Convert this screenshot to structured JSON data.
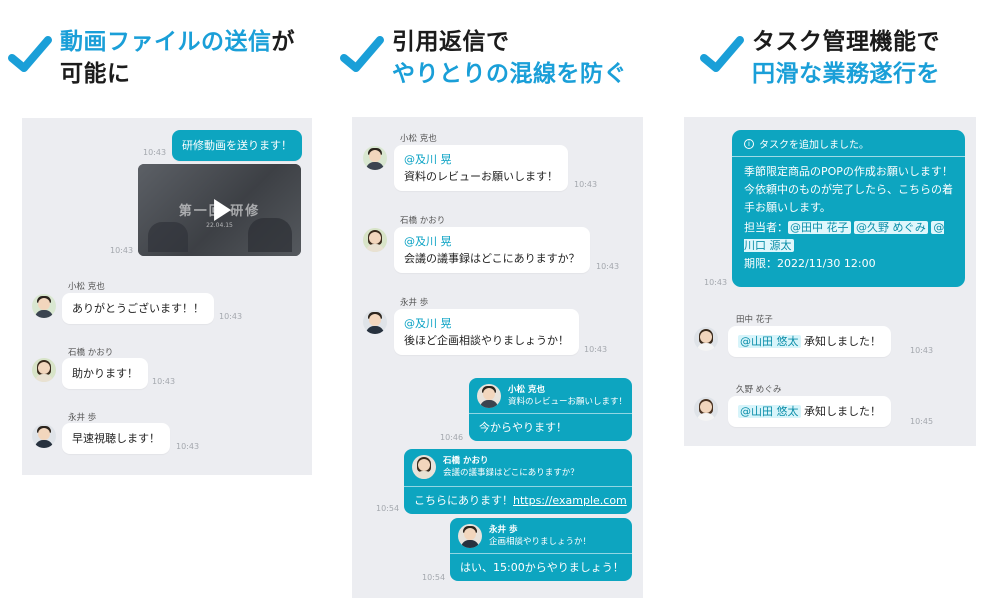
{
  "colors": {
    "accent": "#1a9fd8",
    "teal": "#0da5c0",
    "panel_bg": "#ecedf1"
  },
  "headings": [
    {
      "line1_blue": "動画ファイルの送信",
      "line1_dark": "が",
      "line2_dark": "可能に"
    },
    {
      "line1_dark": "引用返信で",
      "line2_blue": "やりとりの混線を防ぐ"
    },
    {
      "line1_dark": "タスク管理機能で",
      "line2_blue": "円滑な業務遂行を"
    }
  ],
  "panel1": {
    "sent_msg": "研修動画を送ります！",
    "sent_time": "10:43",
    "video_title": "第一回 研修",
    "video_date": "22.04.15",
    "video_time": "10:43",
    "msgs": [
      {
        "name": "小松 克也",
        "text": "ありがとうございます！！",
        "time": "10:43"
      },
      {
        "name": "石橋 かおり",
        "text": "助かります！",
        "time": "10:43"
      },
      {
        "name": "永井 歩",
        "text": "早速視聴します！",
        "time": "10:43"
      }
    ]
  },
  "panel2": {
    "msgs": [
      {
        "name": "小松 克也",
        "mention": "@及川 晃",
        "text": "資料のレビューお願いします！",
        "time": "10:43"
      },
      {
        "name": "石橋 かおり",
        "mention": "@及川 晃",
        "text": "会議の議事録はどこにありますか？",
        "time": "10:43"
      },
      {
        "name": "永井 歩",
        "mention": "@及川 晃",
        "text": "後ほど企画相談やりましょうか！",
        "time": "10:43"
      }
    ],
    "replies": [
      {
        "quote_name": "小松 克也",
        "quote_text": "資料のレビューお願いします！",
        "reply_text": "今からやります！",
        "reply_link": "",
        "time": "10:46"
      },
      {
        "quote_name": "石橋 かおり",
        "quote_text": "会議の議事録はどこにありますか？",
        "reply_text": "こちらにあります！",
        "reply_link": "https://example.com",
        "time": "10:54"
      },
      {
        "quote_name": "永井 歩",
        "quote_text": "企画相談やりましょうか！",
        "reply_text": "はい、15:00からやりましょう！",
        "reply_link": "",
        "time": "10:54"
      }
    ]
  },
  "panel3": {
    "task": {
      "header": "タスクを追加しました。",
      "info_icon": "info-icon",
      "body": "季節限定商品のPOPの作成お願いします！今依頼中のものが完了したら、こちらの着手お願いします。",
      "assignee_label": "担当者：",
      "assignees": [
        "@田中 花子",
        "@久野 めぐみ",
        "@川口 源太"
      ],
      "deadline": "期限：2022/11/30 12:00",
      "time": "10:43"
    },
    "msgs": [
      {
        "name": "田中 花子",
        "mention": "@山田 悠太",
        "text": " 承知しました！",
        "time": "10:43"
      },
      {
        "name": "久野 めぐみ",
        "mention": "@山田 悠太",
        "text": " 承知しました！",
        "time": "10:45"
      }
    ]
  }
}
